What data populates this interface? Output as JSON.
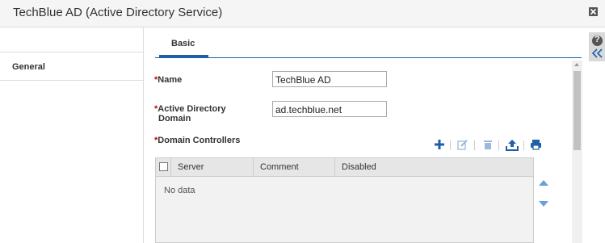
{
  "window": {
    "title": "TechBlue AD (Active Directory Service)"
  },
  "sidebar": {
    "items": [
      {
        "label": "General"
      }
    ]
  },
  "tabs": [
    {
      "label": "Basic"
    }
  ],
  "form": {
    "name_label": "Name",
    "name_value": "TechBlue AD",
    "domain_label_line1": "Active Directory",
    "domain_label_line2": "Domain",
    "domain_value": "ad.techblue.net",
    "controllers_label": "Domain Controllers",
    "required_marker": "*"
  },
  "toolbar": {
    "icons": [
      "add-icon",
      "edit-icon",
      "delete-icon",
      "upload-icon",
      "print-icon"
    ],
    "colors": {
      "active": "#1e5fa8",
      "disabled": "#9ab9dc"
    }
  },
  "grid": {
    "columns": [
      "Server",
      "Comment",
      "Disabled"
    ],
    "empty_text": "No data"
  },
  "help": {
    "glyph": "?"
  }
}
